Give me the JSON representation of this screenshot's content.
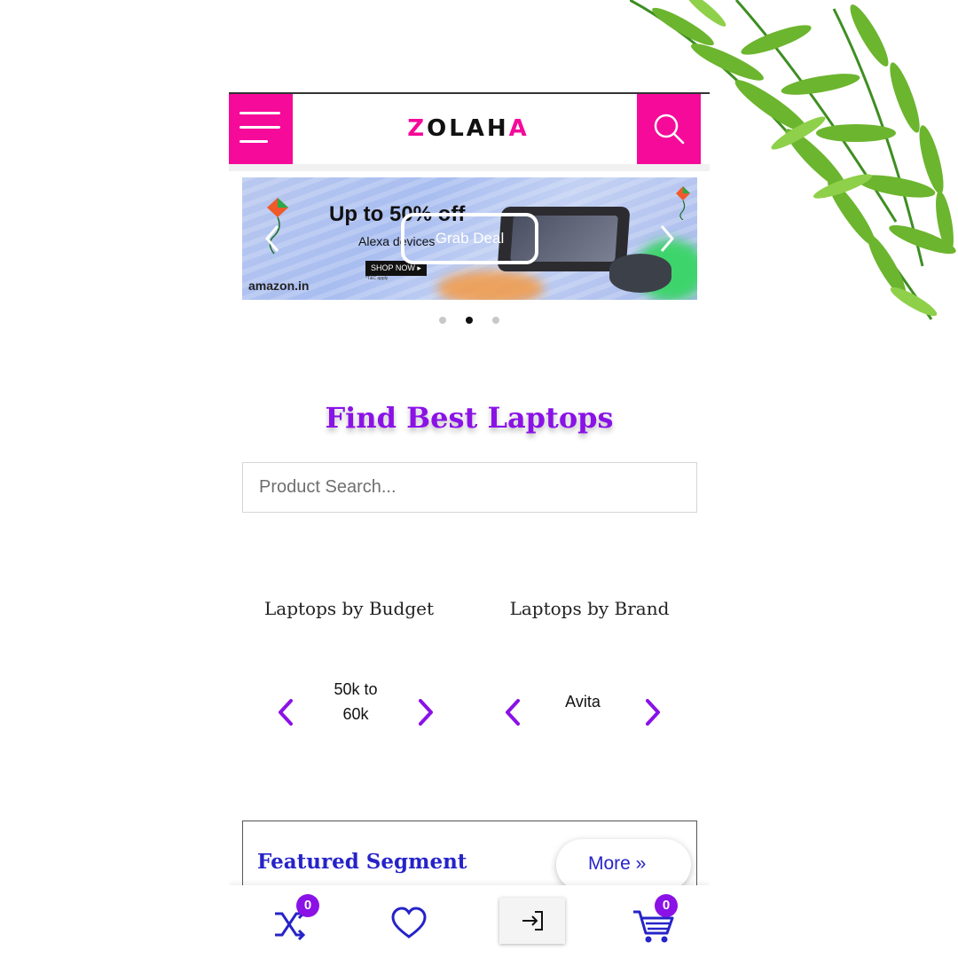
{
  "brand": {
    "logo_text": "ZOLAHA",
    "accent_color": "#f50a9a"
  },
  "header": {
    "menu_icon": "hamburger-icon",
    "search_icon": "search-icon"
  },
  "banner": {
    "headline": "Up to 50% off",
    "subline": "Alexa devices",
    "shop_label": "SHOP NOW ▸",
    "terms": "*T&C apply",
    "brand": "amazon.in",
    "cta": "Grab Deal",
    "prev_icon": "chevron-left-icon",
    "next_icon": "chevron-right-icon",
    "slides": 3,
    "active_slide": 1
  },
  "search": {
    "title": "Find Best Laptops",
    "placeholder": "Product Search..."
  },
  "categories": {
    "budget": {
      "label": "Laptops by Budget",
      "value_line1": "50k to",
      "value_line2": "60k"
    },
    "brand": {
      "label": "Laptops by Brand",
      "value": "Avita"
    },
    "accent_color": "#8a12e6"
  },
  "featured": {
    "title": "Featured Segment",
    "more_label": "More »"
  },
  "bottom_nav": {
    "compare_count": "0",
    "cart_count": "0",
    "icons": [
      "shuffle-icon",
      "heart-icon",
      "login-icon",
      "cart-icon"
    ]
  }
}
